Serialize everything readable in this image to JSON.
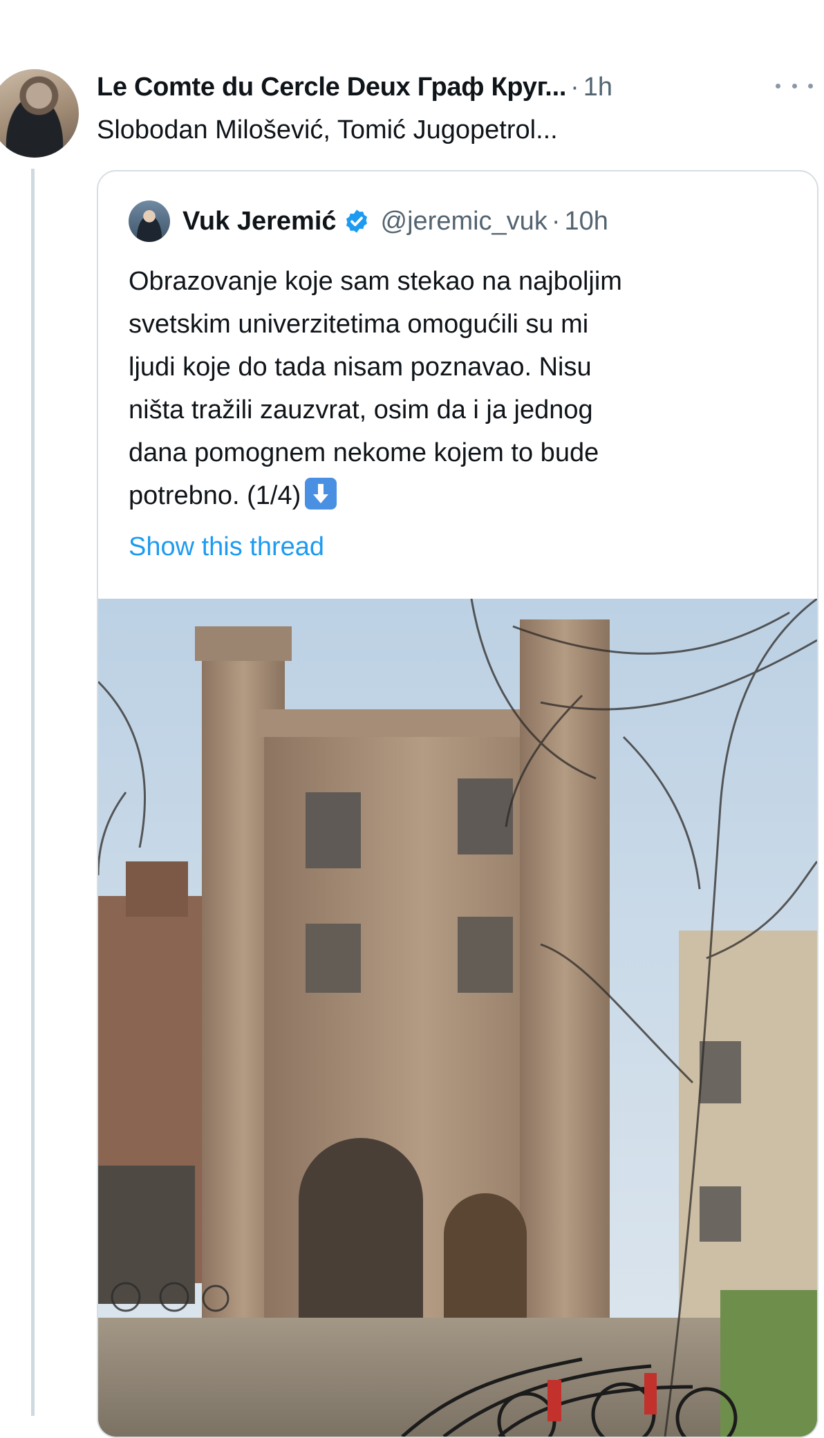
{
  "tweet": {
    "display_name": "Le Comte du Cercle Deux Граф Круг...",
    "separator": "·",
    "time": "1h",
    "text": "Slobodan Milošević, Tomić Jugopetrol..."
  },
  "quoted_tweet": {
    "display_name": "Vuk Jeremić",
    "verified_icon": "verified-badge-icon",
    "handle": "@jeremic_vuk",
    "separator": "·",
    "time": "10h",
    "body_lines": [
      "Obrazovanje koje sam stekao na najboljim",
      "svetskim univerzitetima omogućili su mi",
      "ljudi koje do tada nisam poznavao. Nisu",
      "ništa tražili zauzvrat, osim da i ja jednog",
      "dana pomognem nekome kojem to bude",
      "potrebno. (1/4)"
    ],
    "emoji": "down-arrow-emoji",
    "show_thread": "Show this thread",
    "photo": "college-gatehouse-photo"
  },
  "colors": {
    "text": "#0f1419",
    "secondary": "#536471",
    "link": "#1d9bf0",
    "border": "#d6dee3",
    "thread_line": "#cfd9de"
  }
}
